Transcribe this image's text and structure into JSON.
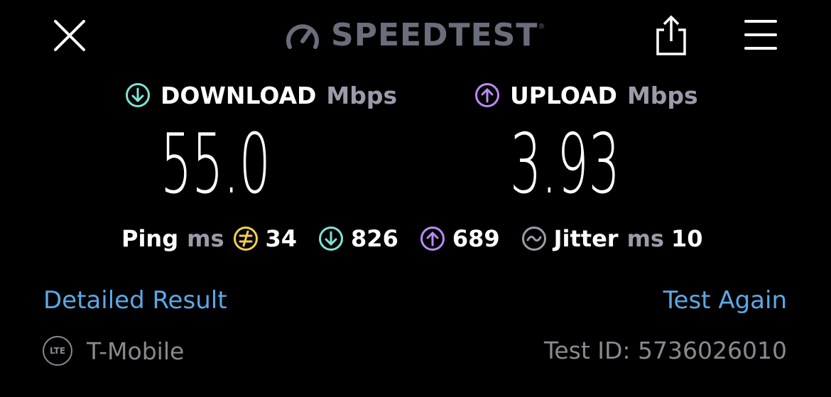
{
  "header": {
    "close_icon": "close-icon",
    "brand": "SPEEDTEST",
    "brand_mark": "®",
    "share_icon": "share-icon",
    "menu_icon": "hamburger-menu-icon"
  },
  "download": {
    "label": "DOWNLOAD",
    "unit": "Mbps",
    "value": "55.0",
    "icon_color": "#7fe3d6"
  },
  "upload": {
    "label": "UPLOAD",
    "unit": "Mbps",
    "value": "3.93",
    "icon_color": "#b98cf5"
  },
  "stats": {
    "ping_label": "Ping",
    "ping_unit": "ms",
    "idle_ping": "34",
    "idle_icon_color": "#f3d14a",
    "download_ping": "826",
    "upload_ping": "689",
    "jitter_label": "Jitter",
    "jitter_unit": "ms",
    "jitter_value": "10"
  },
  "links": {
    "detailed": "Detailed Result",
    "again": "Test Again",
    "color": "#5aa9e6"
  },
  "footer": {
    "network_badge": "LTE",
    "carrier": "T-Mobile",
    "test_id": "Test ID: 5736026010"
  }
}
